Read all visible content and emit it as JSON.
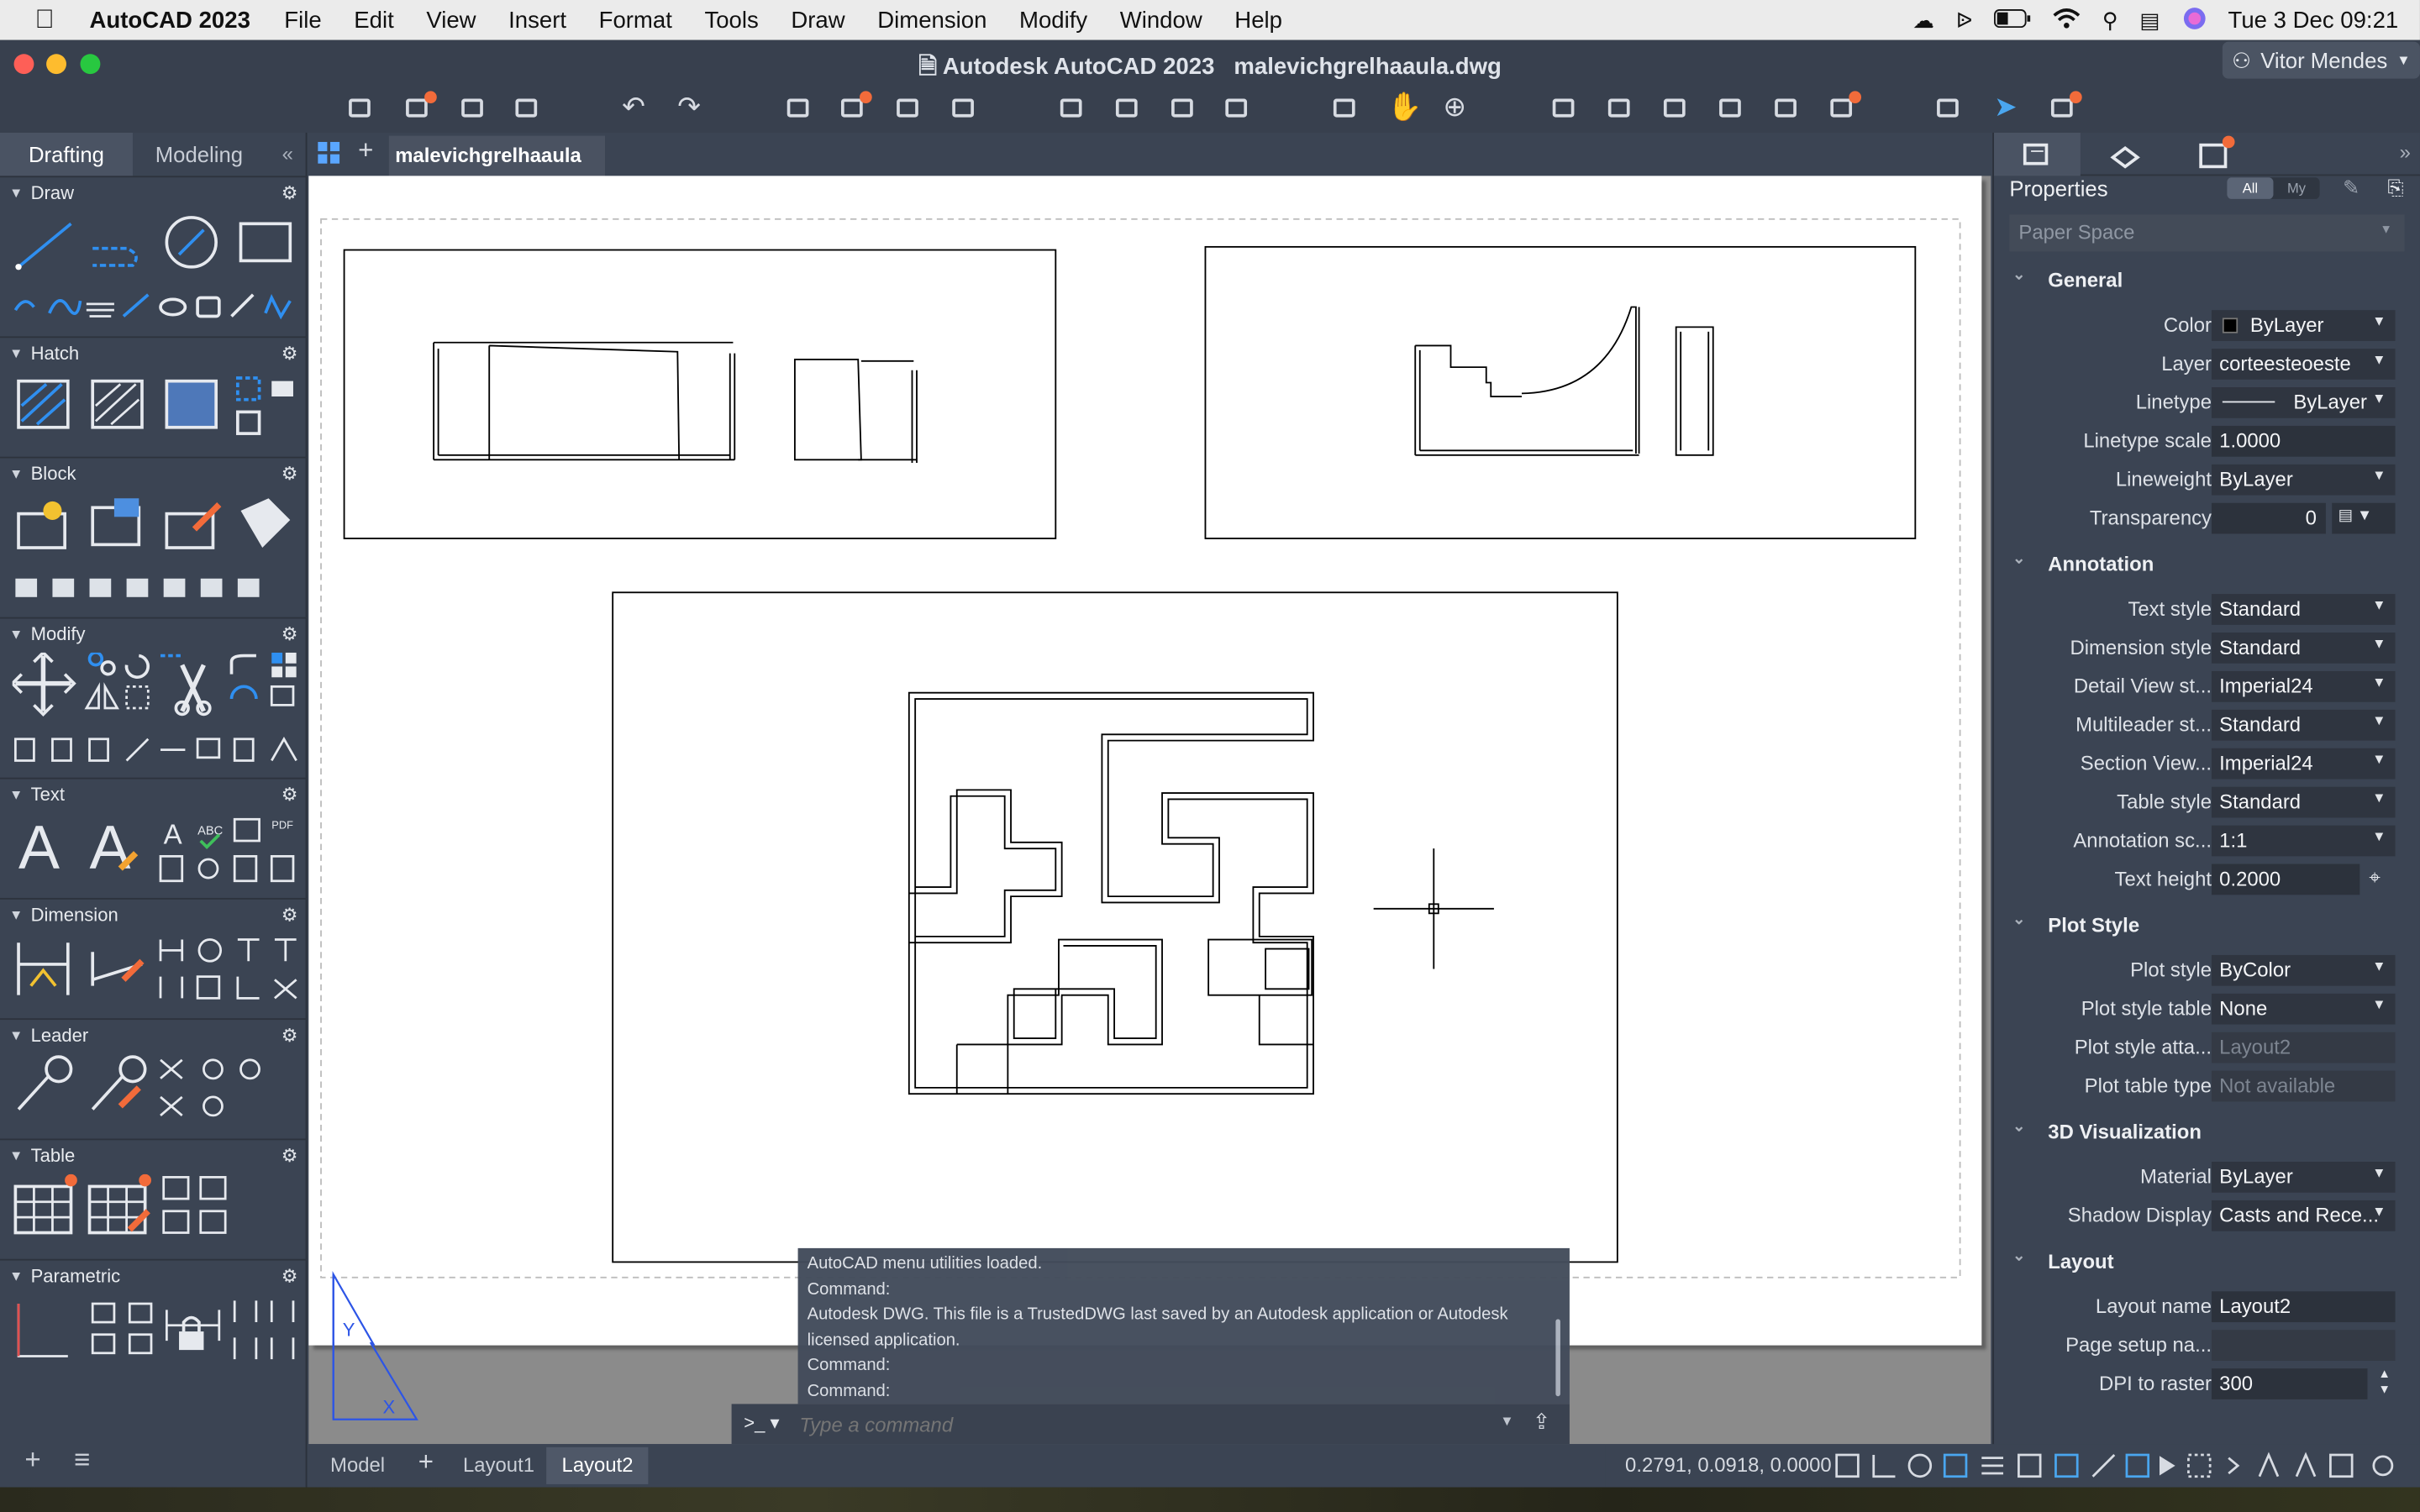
{
  "menubar": {
    "app_name": "AutoCAD 2023",
    "items": [
      "File",
      "Edit",
      "View",
      "Insert",
      "Format",
      "Tools",
      "Draw",
      "Dimension",
      "Modify",
      "Window",
      "Help"
    ],
    "clock": "Tue 3 Dec  09:21"
  },
  "window": {
    "app_title": "Autodesk AutoCAD 2023",
    "file_name": "malevichgrelhaaula.dwg",
    "user_name": "Vitor Mendes"
  },
  "palette": {
    "tabs": [
      "Drafting",
      "Modeling"
    ],
    "active_tab": "Drafting",
    "sections": [
      "Draw",
      "Hatch",
      "Block",
      "Modify",
      "Text",
      "Dimension",
      "Leader",
      "Table",
      "Parametric"
    ]
  },
  "doc_tab": {
    "label": "malevichgrelhaaula"
  },
  "command": {
    "history": [
      "AutoCAD menu utilities loaded.",
      "Command:",
      "Autodesk DWG.  This file is a TrustedDWG last saved by an Autodesk application or Autodesk licensed application.",
      "Command:",
      "Command:"
    ],
    "prompt_symbol": ">_",
    "placeholder": "Type a command"
  },
  "layout_tabs": {
    "items": [
      "Model",
      "Layout1",
      "Layout2"
    ],
    "active": "Layout2"
  },
  "status": {
    "coordinates": "0.2791, 0.0918, 0.0000"
  },
  "properties": {
    "title": "Properties",
    "filter_all": "All",
    "filter_my": "My",
    "selection": "Paper Space",
    "general": {
      "heading": "General",
      "color_label": "Color",
      "color_value": "ByLayer",
      "layer_label": "Layer",
      "layer_value": "corteesteoeste",
      "linetype_label": "Linetype",
      "linetype_value": "ByLayer",
      "linetype_scale_label": "Linetype scale",
      "linetype_scale_value": "1.0000",
      "lineweight_label": "Lineweight",
      "lineweight_value": "ByLayer",
      "transparency_label": "Transparency",
      "transparency_value": "0"
    },
    "annotation": {
      "heading": "Annotation",
      "text_style_label": "Text style",
      "text_style_value": "Standard",
      "dim_style_label": "Dimension style",
      "dim_style_value": "Standard",
      "detail_view_label": "Detail View st...",
      "detail_view_value": "Imperial24",
      "multileader_label": "Multileader st...",
      "multileader_value": "Standard",
      "section_view_label": "Section View...",
      "section_view_value": "Imperial24",
      "table_style_label": "Table style",
      "table_style_value": "Standard",
      "anno_scale_label": "Annotation sc...",
      "anno_scale_value": "1:1",
      "text_height_label": "Text height",
      "text_height_value": "0.2000"
    },
    "plot_style": {
      "heading": "Plot Style",
      "plot_style_label": "Plot style",
      "plot_style_value": "ByColor",
      "plot_style_table_label": "Plot style table",
      "plot_style_table_value": "None",
      "plot_style_attached_label": "Plot style atta...",
      "plot_style_attached_value": "Layout2",
      "plot_table_type_label": "Plot table type",
      "plot_table_type_value": "Not available"
    },
    "visualization": {
      "heading": "3D Visualization",
      "material_label": "Material",
      "material_value": "ByLayer",
      "shadow_label": "Shadow Display",
      "shadow_value": "Casts and Rece..."
    },
    "layout": {
      "heading": "Layout",
      "layout_name_label": "Layout name",
      "layout_name_value": "Layout2",
      "page_setup_label": "Page setup na...",
      "page_setup_value": "",
      "dpi_label": "DPI to raster",
      "dpi_value": "300"
    }
  },
  "colors": {
    "accent_badge": "#f26b3a",
    "ucs_icon": "#2d55e6"
  }
}
